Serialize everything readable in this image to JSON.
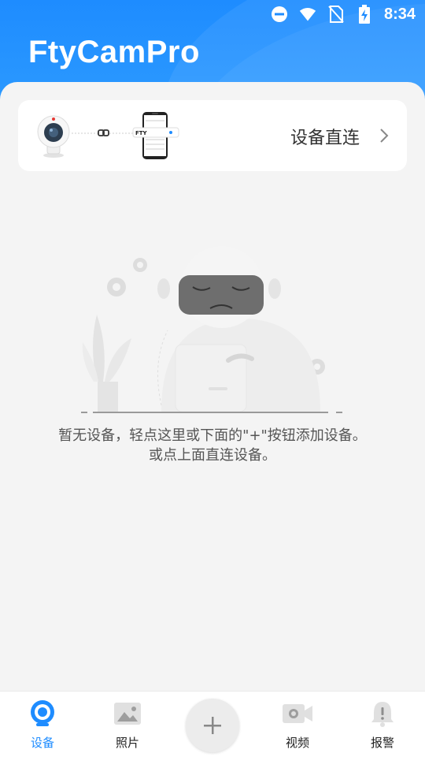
{
  "status_bar": {
    "time": "8:34",
    "icons": [
      "do-not-disturb-icon",
      "wifi-icon",
      "no-sim-icon",
      "battery-charging-icon"
    ]
  },
  "header": {
    "app_title": "FtyCamPro"
  },
  "direct_connect": {
    "label": "设备直连",
    "phone_screen_text": "FTY"
  },
  "empty_state": {
    "line1": "暂无设备，轻点这里或下面的\"+\"按钮添加设备。",
    "line2": "或点上面直连设备。"
  },
  "tabbar": {
    "tabs": [
      {
        "label": "设备",
        "icon": "camera-icon",
        "active": true
      },
      {
        "label": "照片",
        "icon": "image-icon",
        "active": false
      },
      {
        "label": "视频",
        "icon": "video-icon",
        "active": false
      },
      {
        "label": "报警",
        "icon": "bell-alert-icon",
        "active": false
      }
    ],
    "add_icon": "plus-icon"
  },
  "colors": {
    "primary": "#1e8cff",
    "background": "#f4f4f4",
    "text": "#333333"
  }
}
